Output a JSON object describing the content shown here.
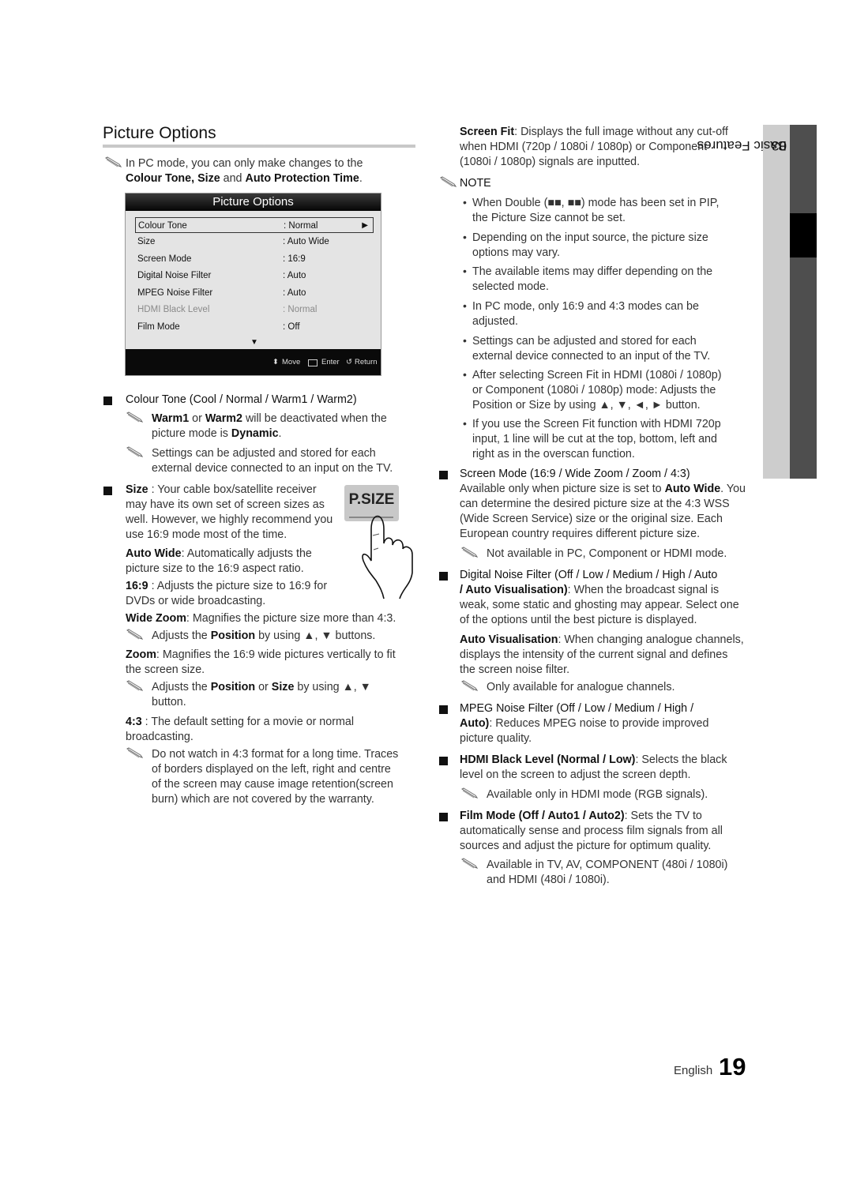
{
  "page": {
    "title": "Picture Options",
    "chapter_number": "03",
    "chapter_title": "Basic Features",
    "footer_language": "English",
    "page_number": "19"
  },
  "intro_note": {
    "line1": "In PC mode, you can only make changes to the",
    "line2_parts": [
      "Colour Tone, Size",
      " and ",
      "Auto Protection Time",
      "."
    ]
  },
  "osd_menu": {
    "title": "Picture Options",
    "rows": [
      {
        "label": "Colour Tone",
        "value": ": Normal",
        "selected": true,
        "dimmed": false
      },
      {
        "label": "Size",
        "value": ": Auto Wide",
        "selected": false,
        "dimmed": false
      },
      {
        "label": "Screen Mode",
        "value": ": 16:9",
        "selected": false,
        "dimmed": false
      },
      {
        "label": "Digital Noise Filter",
        "value": ": Auto",
        "selected": false,
        "dimmed": false
      },
      {
        "label": "MPEG Noise Filter",
        "value": ": Auto",
        "selected": false,
        "dimmed": false
      },
      {
        "label": "HDMI Black Level",
        "value": ": Normal",
        "selected": false,
        "dimmed": true
      },
      {
        "label": "Film Mode",
        "value": ": Off",
        "selected": false,
        "dimmed": false
      }
    ],
    "right_arrow": "▶",
    "down_arrow": "▼",
    "footer": {
      "move": "Move",
      "enter": "Enter",
      "return": "Return"
    }
  },
  "left_column": {
    "colour_tone": {
      "heading": "Colour Tone (Cool / Normal / Warm1 / Warm2)",
      "note1_parts": [
        "Warm1",
        " or ",
        "Warm2",
        " will be deactivated when the"
      ],
      "note1_line2_parts": [
        "picture mode is ",
        "Dynamic",
        "."
      ],
      "note2_line1": "Settings can be adjusted and stored for each",
      "note2_line2": "external device connected to an input on the TV."
    },
    "size": {
      "heading_bold": "Size",
      "line1": " : Your cable box/satellite receiver",
      "line2": "may have its own set of screen sizes as",
      "line3": "well. However, we highly recommend you",
      "line4": "use 16:9 mode most of the time.",
      "button_label": "P.SIZE",
      "auto_wide_bold": "Auto Wide",
      "auto_wide_l1": ": Automatically adjusts the",
      "auto_wide_l2": "picture size to the 16:9 aspect ratio.",
      "r169_bold": "16:9",
      "r169_l1": " : Adjusts the picture size to 16:9 for",
      "r169_l2": "DVDs or wide broadcasting.",
      "wide_zoom_bold": "Wide Zoom",
      "wide_zoom_l1": ": Magnifies the picture size more than 4:3.",
      "wide_zoom_note_parts": [
        "Adjusts the ",
        "Position",
        " by using ▲, ▼ buttons."
      ],
      "zoom_bold": "Zoom",
      "zoom_l1": ": Magnifies the 16:9 wide pictures vertically to fit",
      "zoom_l2": "the screen size.",
      "zoom_note_parts": [
        "Adjusts the ",
        "Position",
        " or ",
        "Size",
        " by using ▲, ▼"
      ],
      "zoom_note_l2": "button.",
      "r43_bold": "4:3",
      "r43_l1": " : The default setting for a movie or normal",
      "r43_l2": "broadcasting.",
      "r43_note": [
        "Do not watch in 4:3 format for a long time. Traces",
        "of borders displayed on the left, right and centre",
        "of the screen may cause image retention(screen",
        "burn) which are not covered by the warranty."
      ]
    }
  },
  "right_column": {
    "screen_fit": {
      "bold": "Screen Fit",
      "l1": ": Displays the full image without any cut-off",
      "l2": "when HDMI (720p / 1080i / 1080p) or Component",
      "l3": "(1080i / 1080p) signals are inputted."
    },
    "note_heading": "NOTE",
    "note_bullets": [
      [
        "When Double (■■, ■■) mode has been set in PIP,",
        "the Picture Size cannot be set."
      ],
      [
        "Depending on the input source, the picture size",
        "options may vary."
      ],
      [
        "The available items may differ depending on the",
        "selected mode."
      ],
      [
        "In PC mode, only 16:9 and 4:3 modes can be",
        "adjusted."
      ],
      [
        "Settings can be adjusted and stored for each",
        "external device connected to an input of the TV."
      ],
      [
        "After selecting Screen Fit in HDMI (1080i / 1080p)",
        "or Component (1080i / 1080p) mode: Adjusts the",
        "Position or Size by using ▲, ▼, ◄, ► button."
      ],
      [
        "If you use the Screen Fit function with HDMI 720p",
        "input, 1 line will be cut at the top, bottom, left and",
        "right as in the overscan function."
      ]
    ],
    "screen_mode": {
      "heading": "Screen Mode (16:9 / Wide Zoom / Zoom / 4:3)",
      "l1_parts": [
        "Available only when picture size is set to ",
        "Auto Wide",
        ". You"
      ],
      "l2": "can determine the desired picture size at the 4:3 WSS",
      "l3": "(Wide Screen Service) size or the original size. Each",
      "l4": "European country requires different picture size.",
      "note": "Not available in PC, Component or HDMI mode."
    },
    "digital_noise": {
      "heading_l1": "Digital Noise Filter (Off / Low / Medium / High / Auto",
      "heading_l2": "/ Auto Visualisation)",
      "l2_rest": ": When the broadcast signal is",
      "l3": "weak, some static and ghosting may appear. Select one",
      "l4": "of the options until the best picture is displayed.",
      "av_bold": "Auto Visualisation",
      "av_l1": ": When changing analogue channels,",
      "av_l2": "displays the intensity of the current signal and defines",
      "av_l3": "the screen noise filter.",
      "note": "Only available for analogue channels."
    },
    "mpeg_noise": {
      "heading_l1": "MPEG Noise Filter (Off / Low / Medium / High /",
      "heading_l2": "Auto)",
      "l2_rest": ": Reduces MPEG noise to provide improved",
      "l3": "picture quality."
    },
    "hdmi_black": {
      "heading": "HDMI Black Level (Normal / Low)",
      "rest": ": Selects the black",
      "l2": "level on the screen to adjust the screen depth.",
      "note": "Available only in HDMI mode (RGB signals)."
    },
    "film_mode": {
      "heading": "Film Mode (Off / Auto1 / Auto2)",
      "rest": ": Sets the TV to",
      "l2": "automatically sense and process film signals from all",
      "l3": "sources and adjust the picture for optimum quality.",
      "note_l1": "Available in TV, AV, COMPONENT (480i / 1080i)",
      "note_l2": "and HDMI (480i / 1080i)."
    }
  }
}
